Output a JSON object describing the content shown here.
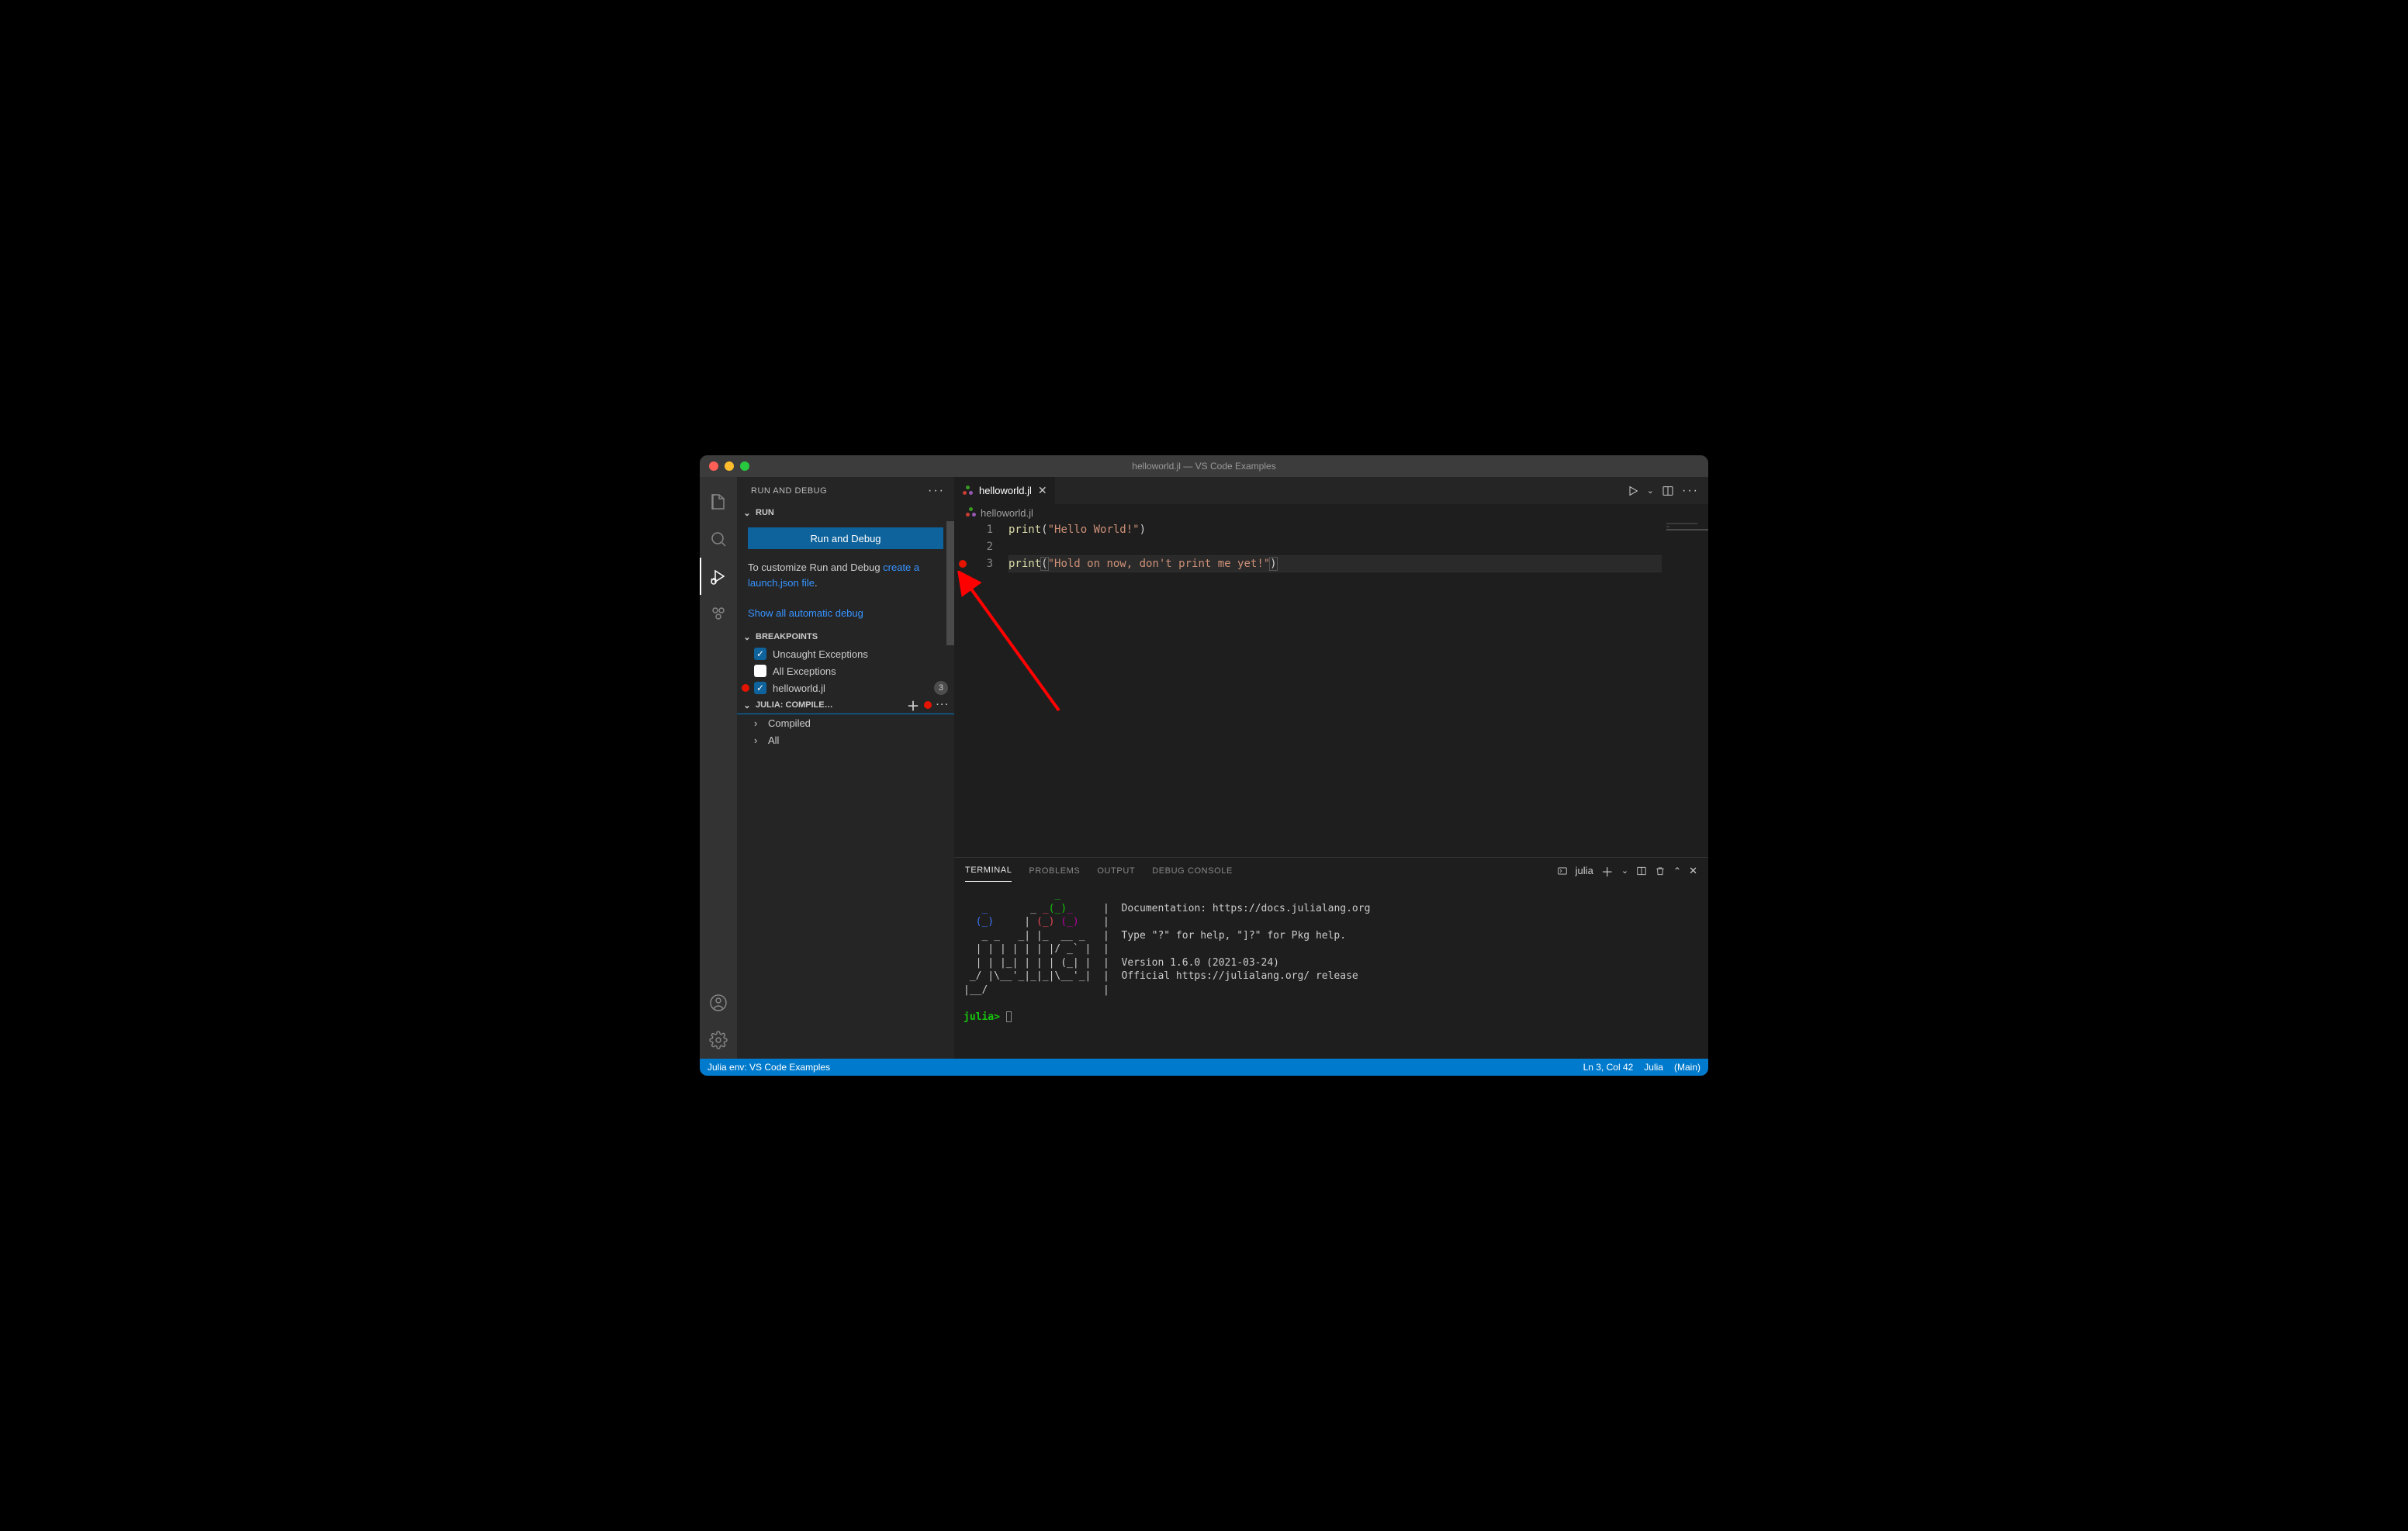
{
  "title": "helloworld.jl — VS Code Examples",
  "sidepanel": {
    "header": "RUN AND DEBUG",
    "run_section": "RUN",
    "run_button": "Run and Debug",
    "customize_pre": "To customize Run and Debug ",
    "customize_link": "create a launch.json file",
    "customize_post": ".",
    "show_auto": "Show all automatic debug",
    "breakpoints_section": "BREAKPOINTS",
    "bp_uncaught": "Uncaught Exceptions",
    "bp_all": "All Exceptions",
    "bp_file": "helloworld.jl",
    "bp_file_badge": "3",
    "julia_section": "JULIA: COMPILE…",
    "tree_compiled": "Compiled",
    "tree_all": "All"
  },
  "tabs": {
    "file_name": "helloworld.jl"
  },
  "breadcrumb": {
    "file": "helloworld.jl"
  },
  "code": {
    "lines": [
      {
        "n": "1",
        "fn": "print",
        "open": "(",
        "str": "\"Hello World!\"",
        "close": ")"
      },
      {
        "n": "2"
      },
      {
        "n": "3",
        "bp": true,
        "current": true,
        "fn": "print",
        "open": "(",
        "str": "\"Hold on now, don't print me yet!\"",
        "close": ")"
      }
    ]
  },
  "panel": {
    "tabs": {
      "terminal": "TERMINAL",
      "problems": "PROBLEMS",
      "output": "OUTPUT",
      "debug": "DEBUG CONSOLE"
    },
    "term_name": "julia",
    "julia_banner": {
      "doc": "Documentation: https://docs.julialang.org",
      "help": "Type \"?\" for help, \"]?\" for Pkg help.",
      "version": "Version 1.6.0 (2021-03-24)",
      "release": "Official https://julialang.org/ release"
    },
    "prompt": "julia>"
  },
  "status": {
    "env": "Julia env: VS Code Examples",
    "pos": "Ln 3, Col 42",
    "lang": "Julia",
    "branch": "(Main)"
  }
}
